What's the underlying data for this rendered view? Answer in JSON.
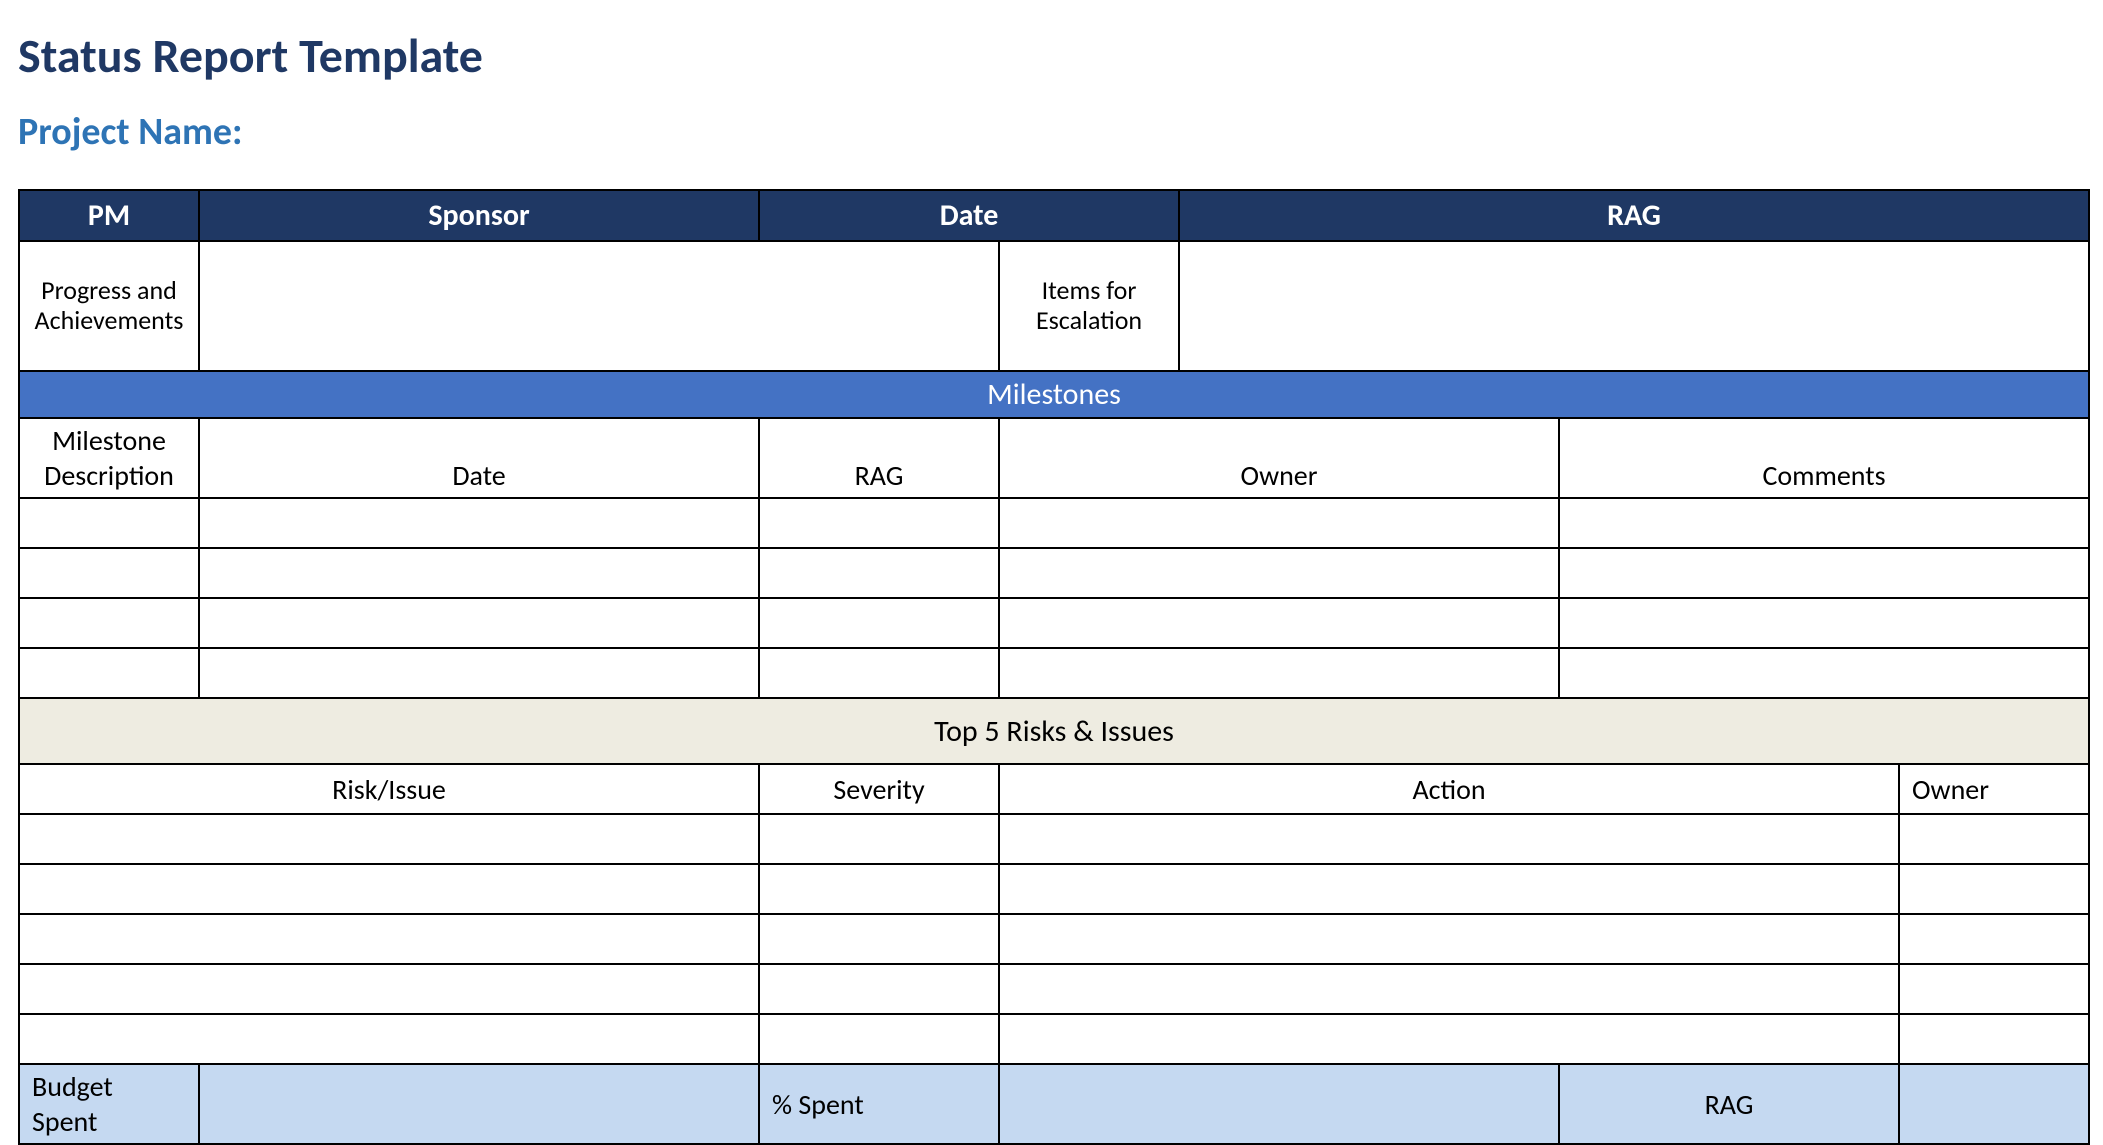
{
  "title": "Status Report Template",
  "subtitle": "Project Name:",
  "headerRow": {
    "pm": "PM",
    "sponsor": "Sponsor",
    "date": "Date",
    "rag": "RAG"
  },
  "progress": {
    "label": "Progress and Achievements",
    "value": ""
  },
  "escalation": {
    "label": "Items for Escalation",
    "value": ""
  },
  "milestones": {
    "banner": "Milestones",
    "headers": {
      "desc": "Milestone Description",
      "date": "Date",
      "rag": "RAG",
      "owner": "Owner",
      "comments": "Comments"
    },
    "rows": [
      {
        "desc": "",
        "date": "",
        "rag": "",
        "owner": "",
        "comments": ""
      },
      {
        "desc": "",
        "date": "",
        "rag": "",
        "owner": "",
        "comments": ""
      },
      {
        "desc": "",
        "date": "",
        "rag": "",
        "owner": "",
        "comments": ""
      },
      {
        "desc": "",
        "date": "",
        "rag": "",
        "owner": "",
        "comments": ""
      }
    ]
  },
  "risks": {
    "banner": "Top 5 Risks & Issues",
    "headers": {
      "risk": "Risk/Issue",
      "severity": "Severity",
      "action": "Action",
      "owner": "Owner"
    },
    "rows": [
      {
        "risk": "",
        "severity": "",
        "action": "",
        "owner": ""
      },
      {
        "risk": "",
        "severity": "",
        "action": "",
        "owner": ""
      },
      {
        "risk": "",
        "severity": "",
        "action": "",
        "owner": ""
      },
      {
        "risk": "",
        "severity": "",
        "action": "",
        "owner": ""
      },
      {
        "risk": "",
        "severity": "",
        "action": "",
        "owner": ""
      }
    ]
  },
  "budget": {
    "spentLabel": "Budget Spent",
    "spentValue": "",
    "pctLabel": "% Spent",
    "pctValue": "",
    "actionValue": "",
    "ragLabel": "RAG",
    "ragValue": ""
  }
}
